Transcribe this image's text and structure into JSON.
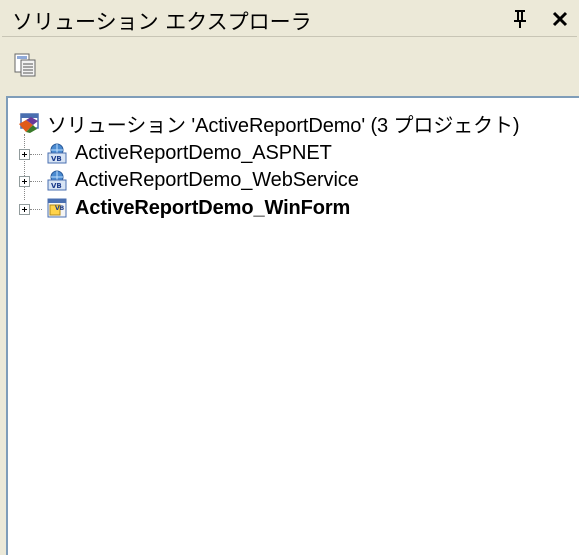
{
  "window": {
    "title": "ソリューション エクスプローラ",
    "pin_icon": "pushpin-icon",
    "close_icon": "close-icon"
  },
  "toolbar": {
    "properties_icon": "properties-icon"
  },
  "tree": {
    "solution": {
      "label": "ソリューション 'ActiveReportDemo' (3 プロジェクト)",
      "icon": "solution-icon"
    },
    "projects": [
      {
        "label": "ActiveReportDemo_ASPNET",
        "icon": "vb-web-project-icon",
        "bold": false
      },
      {
        "label": "ActiveReportDemo_WebService",
        "icon": "vb-web-project-icon",
        "bold": false
      },
      {
        "label": "ActiveReportDemo_WinForm",
        "icon": "vb-winform-project-icon",
        "bold": true
      }
    ]
  }
}
